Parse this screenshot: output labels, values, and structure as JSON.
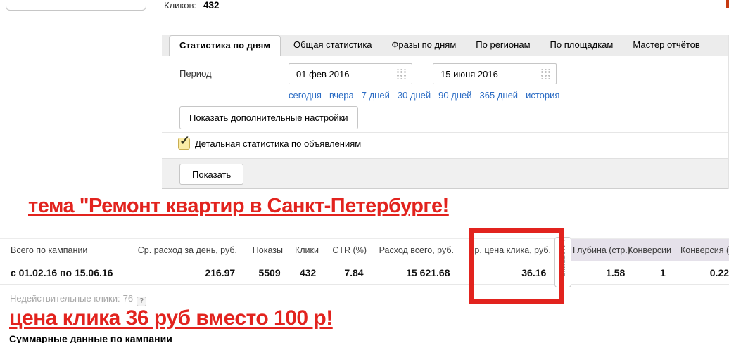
{
  "colors": {
    "annotation_red": "#e2231e",
    "link_blue": "#2b6cc4",
    "metrika_header_bg": "#e5e1ea",
    "tabbar_bg": "#ececec"
  },
  "icons": {
    "checkbox_check": "✓",
    "calendar": "dot-grid",
    "help": "?",
    "metrika_arrow": "»"
  },
  "topbar": {
    "clicks_label": "Кликов:",
    "clicks_value": "432"
  },
  "tabs": {
    "items": [
      "Статистика по дням",
      "Общая статистика",
      "Фразы по дням",
      "По регионам",
      "По площадкам",
      "Мастер отчётов"
    ],
    "active": "Статистика по дням"
  },
  "filter": {
    "period_label": "Период",
    "date_from": "01 фев 2016",
    "date_to": "15 июня 2016",
    "range_dash": "—",
    "quick_ranges": [
      "сегодня",
      "вчера",
      "7 дней",
      "30 дней",
      "90 дней",
      "365 дней",
      "история"
    ],
    "more_settings_button": "Показать дополнительные настройки",
    "detail_checkbox_label": "Детальная статистика по объявлениям",
    "detail_checkbox_checked": true,
    "show_button": "Показать"
  },
  "annotations": {
    "headline_top": "тема \"Ремонт квартир в Санкт-Петербурге!",
    "headline_bottom": "цена клика 36 руб вместо 100 р!"
  },
  "table": {
    "headers": [
      "Всего по кампании",
      "Ср. расход за день, руб.",
      "Показы",
      "Клики",
      "CTR (%)",
      "Расход всего, руб.",
      "Ср. цена клика, руб.",
      "Глубина (стр.)",
      "Конверсии",
      "Конверсия (%)"
    ],
    "row": [
      "с 01.02.16 по 15.06.16",
      "216.97",
      "5509",
      "432",
      "7.84",
      "15 621.68",
      "36.16",
      "1.58",
      "1",
      "0.22"
    ],
    "metrika_tab_label": "метрика",
    "metrika_tab_arrow": "»"
  },
  "footer": {
    "invalid_clicks_label": "Недействительные клики:",
    "invalid_clicks_value": "76",
    "help_icon": "?",
    "summary_title": "Суммарные данные по кампании"
  }
}
